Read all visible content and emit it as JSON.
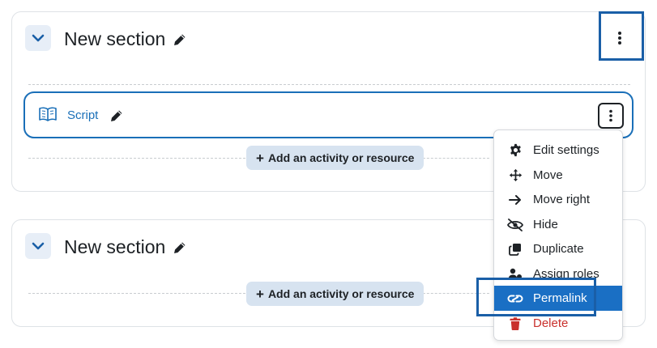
{
  "sections": [
    {
      "title": "New section",
      "add_label": "Add an activity or resource",
      "activity": {
        "name": "Script"
      }
    },
    {
      "title": "New section",
      "add_label": "Add an activity or resource"
    }
  ],
  "menu": {
    "items": [
      {
        "label": "Edit settings",
        "icon": "gear-icon"
      },
      {
        "label": "Move",
        "icon": "move-arrows-icon"
      },
      {
        "label": "Move right",
        "icon": "arrow-right-icon"
      },
      {
        "label": "Hide",
        "icon": "eye-slash-icon"
      },
      {
        "label": "Duplicate",
        "icon": "copy-icon"
      },
      {
        "label": "Assign roles",
        "icon": "user-role-icon"
      },
      {
        "label": "Permalink",
        "icon": "link-icon"
      },
      {
        "label": "Delete",
        "icon": "trash-icon"
      }
    ]
  },
  "colors": {
    "accent": "#1a6fc4",
    "highlight_outline": "#1a5fa7",
    "danger": "#c9302c",
    "button_bg": "#d7e3f0"
  }
}
